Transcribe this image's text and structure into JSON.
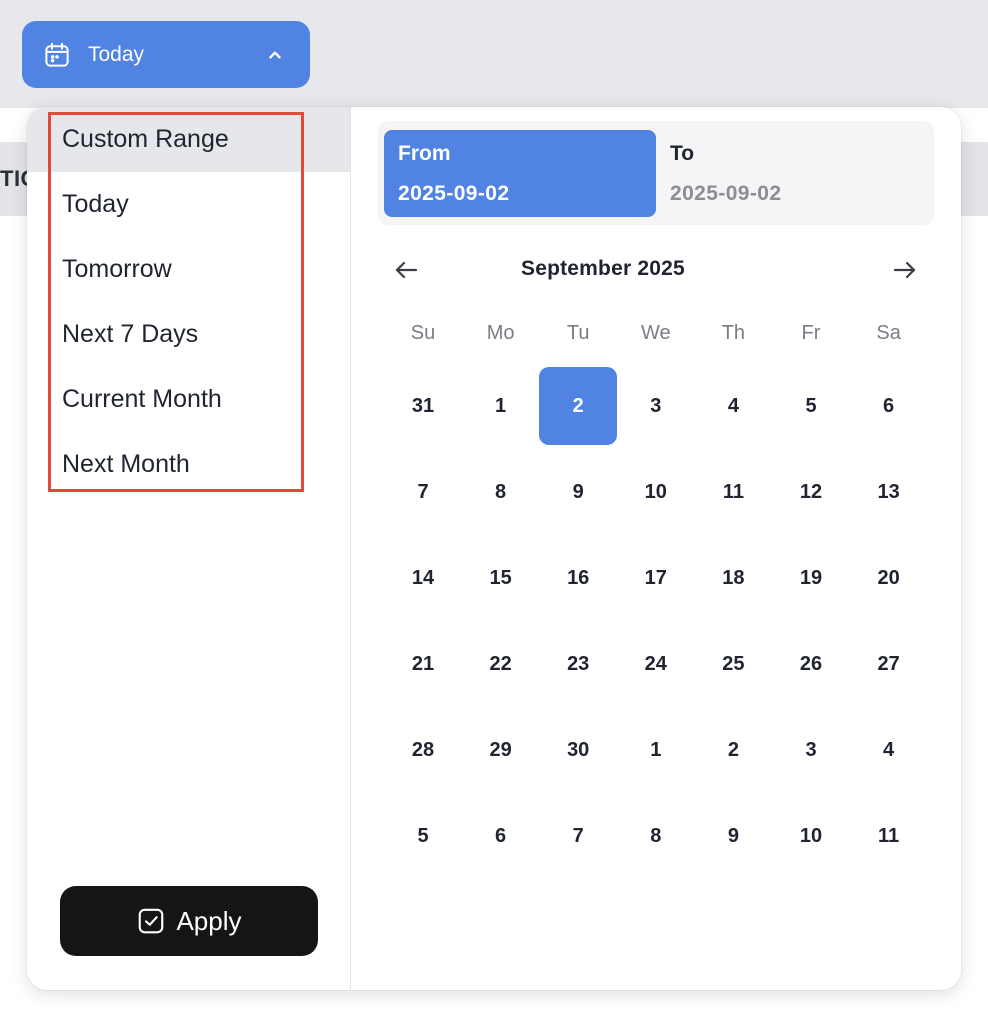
{
  "header": {
    "trigger_label": "Today",
    "sub_bar_text": "TIC"
  },
  "presets": [
    {
      "label": "Custom Range",
      "active": true
    },
    {
      "label": "Today",
      "active": false
    },
    {
      "label": "Tomorrow",
      "active": false
    },
    {
      "label": "Next 7 Days",
      "active": false
    },
    {
      "label": "Current Month",
      "active": false
    },
    {
      "label": "Next Month",
      "active": false
    }
  ],
  "apply_label": "Apply",
  "range": {
    "from_label": "From",
    "from_date": "2025-09-02",
    "to_label": "To",
    "to_date": "2025-09-02"
  },
  "calendar": {
    "month_title": "September 2025",
    "weekdays": [
      "Su",
      "Mo",
      "Tu",
      "We",
      "Th",
      "Fr",
      "Sa"
    ],
    "weeks": [
      [
        "31",
        "1",
        "2",
        "3",
        "4",
        "5",
        "6"
      ],
      [
        "7",
        "8",
        "9",
        "10",
        "11",
        "12",
        "13"
      ],
      [
        "14",
        "15",
        "16",
        "17",
        "18",
        "19",
        "20"
      ],
      [
        "21",
        "22",
        "23",
        "24",
        "25",
        "26",
        "27"
      ],
      [
        "28",
        "29",
        "30",
        "1",
        "2",
        "3",
        "4"
      ],
      [
        "5",
        "6",
        "7",
        "8",
        "9",
        "10",
        "11"
      ]
    ],
    "selected": {
      "week": 0,
      "day": 2
    }
  },
  "colors": {
    "accent": "#5183e3",
    "highlight_border": "#e2493a",
    "apply_bg": "#151515"
  },
  "icons": {
    "trigger": "calendar-icon",
    "trigger_chevron": "chevron-up-icon",
    "apply": "check-square-icon",
    "prev": "arrow-left-icon",
    "next": "arrow-right-icon"
  }
}
